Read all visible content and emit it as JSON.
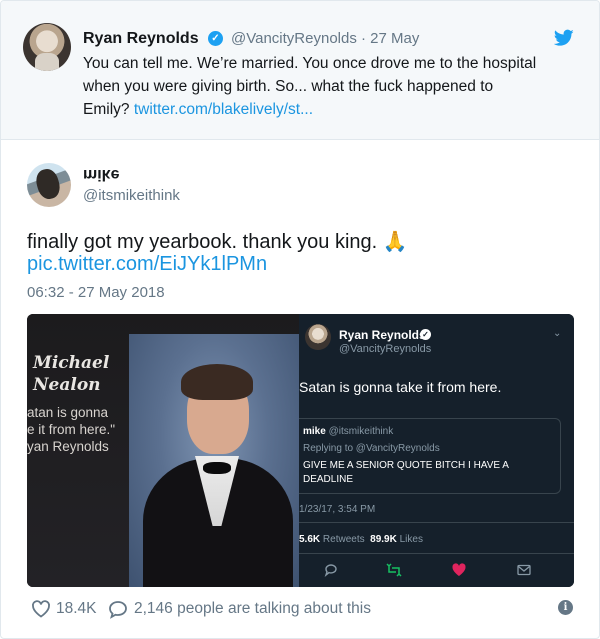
{
  "parent_tweet": {
    "name": "Ryan Reynolds",
    "handle": "@VancityReynolds",
    "date": "27 May",
    "handle_date": "@VancityReynolds · 27 May",
    "text_line1": "You can tell me. We’re married. You once drove me to the hospital",
    "text_line2": "when you were giving birth. So... what the fuck happened to",
    "text_line3_prefix": "Emily? ",
    "link": "twitter.com/blakelively/st...",
    "icons": {
      "avatar": "avatar",
      "verified": "verified-badge-icon",
      "logo": "twitter-bird-icon"
    }
  },
  "main_tweet": {
    "name": "mike",
    "handle": "@itsmikeithink",
    "text": "finally got my yearbook. thank you king. 🙏",
    "link": "pic.twitter.com/EiJYk1lPMn",
    "timestamp": "06:32 - 27 May 2018",
    "media": {
      "yearbook": {
        "name_line1": "Michael",
        "name_line2": "Nealon",
        "quote_line1": "atan is gonna",
        "quote_line2": "e it from here.\"",
        "quote_line3": "yan Reynolds"
      },
      "screenshot": {
        "name": "Ryan Reynolds",
        "handle": "@VancityReynolds",
        "text": "Satan is gonna take it from here.",
        "quoted_name": "mike",
        "quoted_handle": "@itsmikeithink",
        "quoted_reply": "Replying to @VancityReynolds",
        "quoted_text": "GIVE ME A SENIOR QUOTE BITCH I HAVE A DEADLINE",
        "date": "1/23/17, 3:54 PM",
        "retweets_value": "5.6K",
        "retweets_label": "Retweets",
        "likes_value": "89.9K",
        "likes_label": "Likes"
      }
    }
  },
  "footer": {
    "likes": "18.4K",
    "talking": "2,146 people are talking about this"
  },
  "colors": {
    "link": "#1b95e0",
    "muted": "#657786",
    "twitter_blue": "#1da1f2",
    "dark_bg": "#15202b",
    "like_red": "#e0245e"
  }
}
